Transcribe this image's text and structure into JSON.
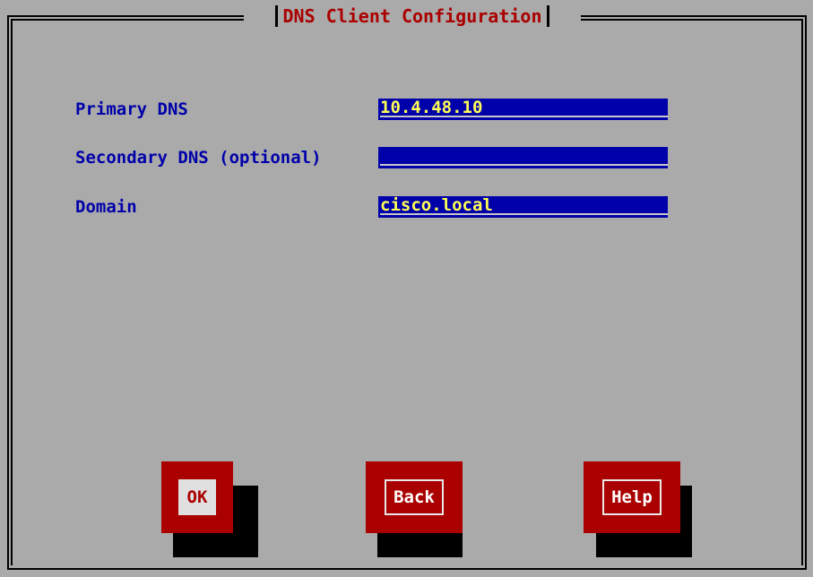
{
  "dialog": {
    "title": "DNS Client Configuration",
    "fields": [
      {
        "label": "Primary DNS",
        "value": "10.4.48.10"
      },
      {
        "label": "Secondary DNS (optional)",
        "value": ""
      },
      {
        "label": "Domain",
        "value": "cisco.local"
      }
    ],
    "buttons": [
      {
        "label": "OK",
        "focused": true
      },
      {
        "label": "Back",
        "focused": false
      },
      {
        "label": "Help",
        "focused": false
      }
    ]
  },
  "colors": {
    "background": "#aaaaaa",
    "label": "#0000aa",
    "title": "#aa0000",
    "field_bg": "#0000aa",
    "field_text": "#ffff55",
    "button_bg": "#aa0000"
  }
}
